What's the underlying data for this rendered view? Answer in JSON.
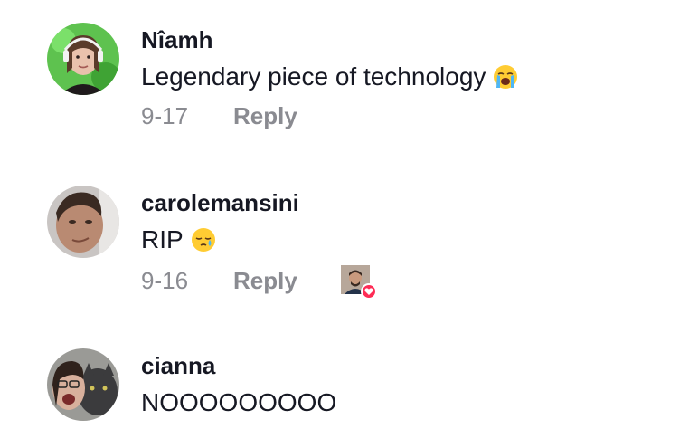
{
  "comments": [
    {
      "username": "Nîamh",
      "text": "Legendary piece of technology",
      "emoji": "loudly-crying-face-emoji",
      "date": "9-17",
      "reply_label": "Reply",
      "creator_liked": false
    },
    {
      "username": "carolemansini",
      "text": "RIP",
      "emoji": "sleepy-face-emoji",
      "date": "9-16",
      "reply_label": "Reply",
      "creator_liked": true
    },
    {
      "username": "cianna",
      "text": "NOOOOOOOOO",
      "emoji": null,
      "date": "",
      "reply_label": "",
      "creator_liked": false
    }
  ],
  "colors": {
    "username": "#161823",
    "secondary": "#8a8b91",
    "like_red": "#fe2c55",
    "emoji_yellow": "#ffcc33"
  }
}
